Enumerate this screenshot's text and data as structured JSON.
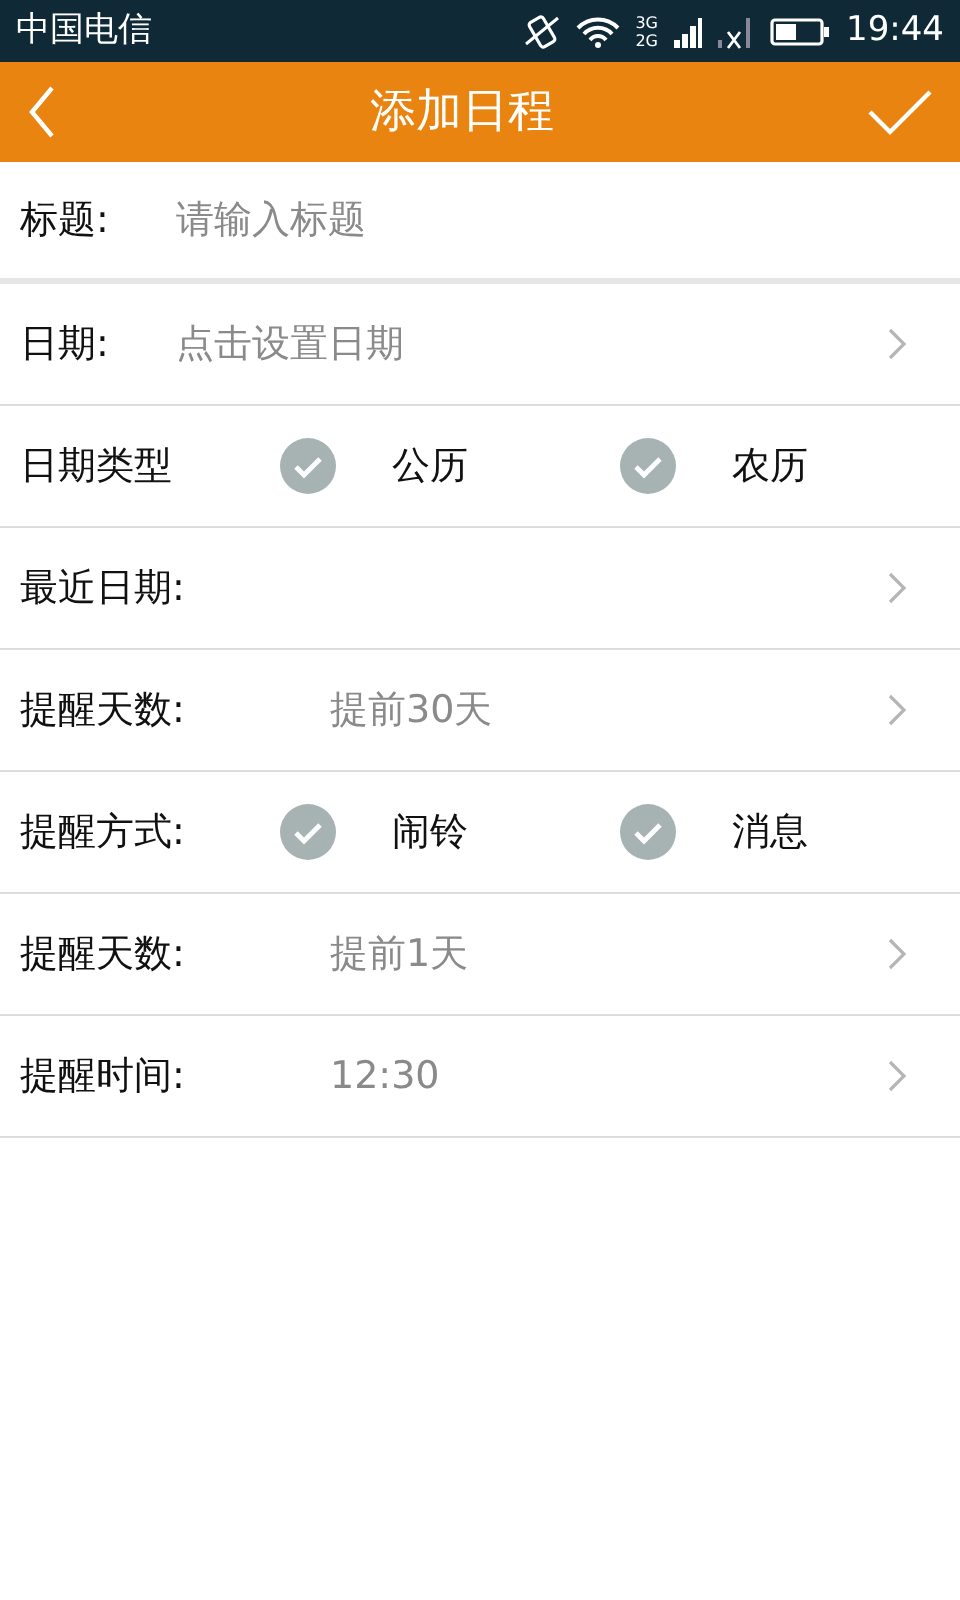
{
  "status_bar": {
    "carrier": "中国电信",
    "network_labels": [
      "3G",
      "2G"
    ],
    "time": "19:44"
  },
  "header": {
    "title": "添加日程"
  },
  "rows": [
    {
      "kind": "input",
      "label": "标题:",
      "placeholder": "请输入标题"
    },
    {
      "kind": "picker",
      "label": "日期:",
      "placeholder": "点击设置日期"
    },
    {
      "kind": "options",
      "label": "日期类型",
      "options": [
        {
          "label": "公历",
          "checked": false
        },
        {
          "label": "农历",
          "checked": false
        }
      ]
    },
    {
      "kind": "detail",
      "label": "最近日期:"
    },
    {
      "kind": "detail",
      "label": "提醒天数:",
      "value": "提前30天"
    },
    {
      "kind": "options",
      "label": "提醒方式:",
      "options": [
        {
          "label": "闹铃",
          "checked": false
        },
        {
          "label": "消息",
          "checked": false
        }
      ]
    },
    {
      "kind": "detail",
      "label": "提醒天数:",
      "value": "提前1天"
    },
    {
      "kind": "detail",
      "label": "提醒时间:",
      "value": "12:30"
    }
  ]
}
